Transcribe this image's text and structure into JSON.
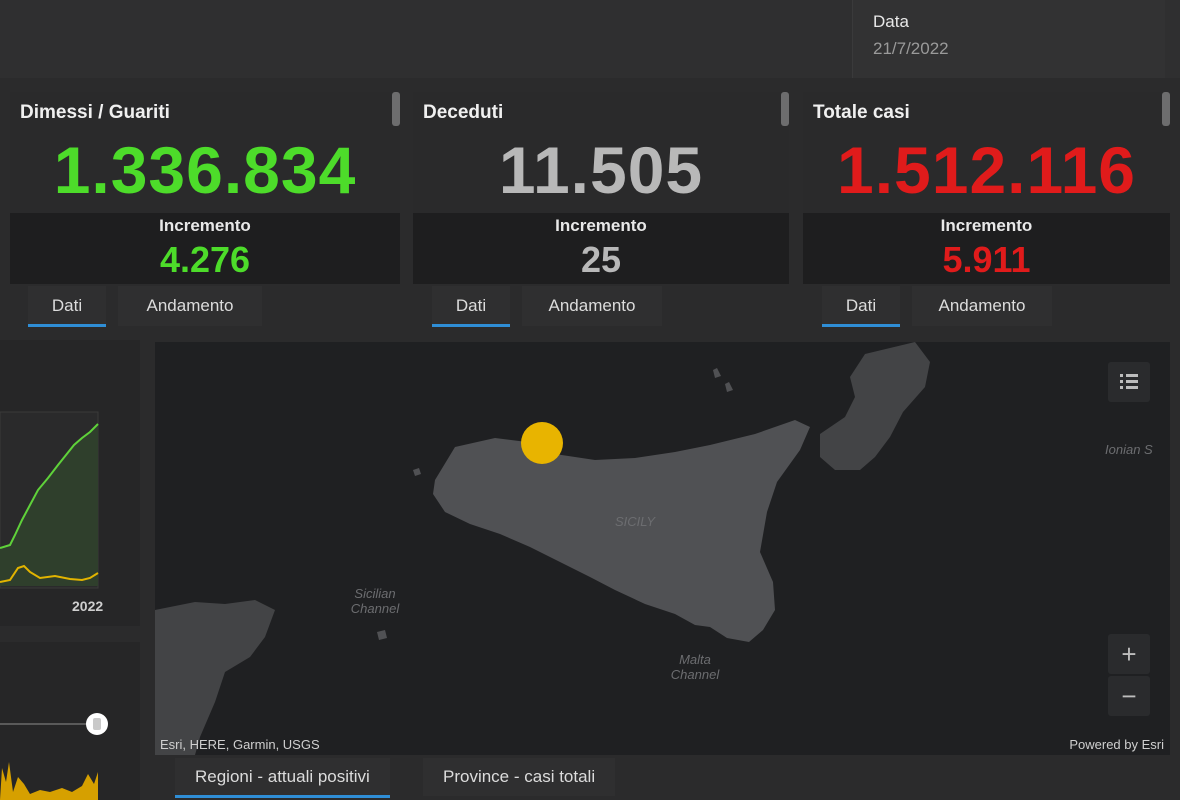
{
  "header": {
    "date_label": "Data",
    "date_value": "21/7/2022"
  },
  "cards": [
    {
      "title": "Dimessi / Guariti",
      "value": "1.336.834",
      "inc_label": "Incremento",
      "inc_value": "4.276",
      "color": "#4ddc2a"
    },
    {
      "title": "Deceduti",
      "value": "11.505",
      "inc_label": "Incremento",
      "inc_value": "25",
      "color": "#b8b8b8"
    },
    {
      "title": "Totale casi",
      "value": "1.512.116",
      "inc_label": "Incremento",
      "inc_value": "5.911",
      "color": "#e01b1b"
    }
  ],
  "tabs": {
    "dati": "Dati",
    "andamento": "Andamento"
  },
  "left_chart": {
    "year_label": "2022"
  },
  "map": {
    "labels": {
      "sicily": "SICILY",
      "sicilian_channel": "Sicilian Channel",
      "malta_channel": "Malta Channel",
      "ionian": "Ionian S"
    },
    "attribution_left": "Esri, HERE, Garmin, USGS",
    "attribution_right": "Powered by Esri",
    "zoom_in": "+",
    "zoom_out": "−",
    "legend_icon": "list-icon"
  },
  "bottom_tabs": [
    "Regioni - attuali positivi",
    "Province - casi totali"
  ]
}
